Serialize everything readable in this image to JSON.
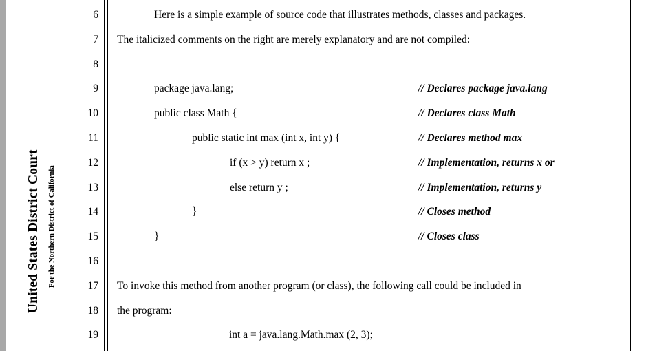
{
  "court_caption": {
    "title": "United States District Court",
    "subtitle": "For the Northern District of California"
  },
  "document": {
    "line_numbers": [
      "6",
      "7",
      "8",
      "9",
      "10",
      "11",
      "12",
      "13",
      "14",
      "15",
      "16",
      "17",
      "18",
      "19"
    ],
    "lines": [
      {
        "number": "6",
        "text": "Here is a simple example of source code that illustrates methods, classes and packages.",
        "style": "indent-para",
        "comment": ""
      },
      {
        "number": "7",
        "text": "The italicized comments on the right are merely explanatory and are not compiled:",
        "style": "margin",
        "comment": ""
      },
      {
        "number": "8",
        "text": "",
        "style": "margin",
        "comment": ""
      },
      {
        "number": "9",
        "text": "package java.lang;",
        "style": "code-1",
        "comment": "// Declares package java.lang"
      },
      {
        "number": "10",
        "text": "public class Math {",
        "style": "code-1",
        "comment": "// Declares class Math"
      },
      {
        "number": "11",
        "text": "public static int max (int x, int y) {",
        "style": "code-2",
        "comment": "// Declares method max"
      },
      {
        "number": "12",
        "text": "if (x > y) return x ;",
        "style": "code-3",
        "comment": "// Implementation, returns x or"
      },
      {
        "number": "13",
        "text": "else return y ;",
        "style": "code-3",
        "comment": "// Implementation, returns y"
      },
      {
        "number": "14",
        "text": "}",
        "style": "code-2",
        "comment": "// Closes method"
      },
      {
        "number": "15",
        "text": "}",
        "style": "code-1",
        "comment": "// Closes class"
      },
      {
        "number": "16",
        "text": "",
        "style": "margin",
        "comment": ""
      },
      {
        "number": "17",
        "text": "To invoke this method from another program (or class), the following call could be included in",
        "style": "margin",
        "comment": ""
      },
      {
        "number": "18",
        "text": "the program:",
        "style": "margin",
        "comment": ""
      },
      {
        "number": "19",
        "text": "int a = java.lang.Math.max (2, 3);",
        "style": "call",
        "comment": ""
      }
    ]
  },
  "colors": {
    "page_background": "#ffffff",
    "viewer_gutter": "#a8a8a8",
    "rule": "#000000",
    "page_edge": "#c9c9cf",
    "text": "#000000"
  }
}
